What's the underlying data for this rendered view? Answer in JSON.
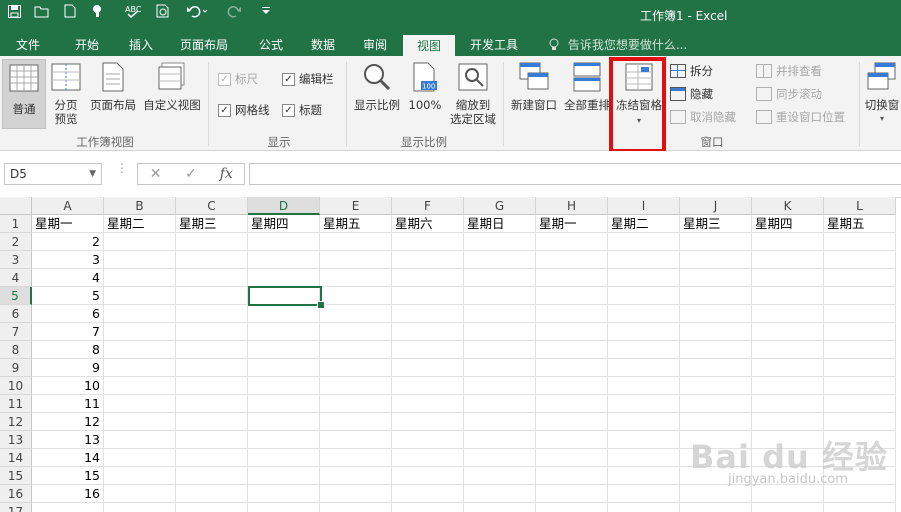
{
  "window": {
    "title": "工作簿1 - Excel"
  },
  "qat": [
    "save-icon",
    "open-folder-icon",
    "new-file-icon",
    "touch-mode-icon",
    "spell-check-icon",
    "print-preview-icon",
    "undo-icon",
    "redo-icon",
    "customize-qat-icon"
  ],
  "tabs": [
    {
      "label": "文件"
    },
    {
      "label": "开始"
    },
    {
      "label": "插入"
    },
    {
      "label": "页面布局"
    },
    {
      "label": "公式"
    },
    {
      "label": "数据"
    },
    {
      "label": "审阅"
    },
    {
      "label": "视图"
    },
    {
      "label": "开发工具"
    }
  ],
  "active_tab": "视图",
  "tell_me": "告诉我您想要做什么...",
  "ribbon": {
    "workbook_views": {
      "label": "工作簿视图",
      "normal": "普通",
      "page_break": "分页\n预览",
      "page_layout": "页面布局",
      "custom": "自定义视图"
    },
    "show": {
      "label": "显示",
      "ruler": "标尺",
      "formula_bar": "编辑栏",
      "gridlines": "网格线",
      "headings": "标题"
    },
    "zoom": {
      "label": "显示比例",
      "zoom": "显示比例",
      "hundred": "100%",
      "hundred_icon_text": "100",
      "to_selection": "缩放到\n选定区域"
    },
    "window": {
      "label": "窗口",
      "new_window": "新建窗口",
      "arrange_all": "全部重排",
      "freeze_panes": "冻结窗格",
      "split": "拆分",
      "hide": "隐藏",
      "unhide": "取消隐藏",
      "side_by_side": "并排查看",
      "sync_scroll": "同步滚动",
      "reset_position": "重设窗口位置",
      "switch": "切换窗"
    }
  },
  "formula_bar": {
    "name_box": "D5",
    "cancel": "✕",
    "enter": "✓",
    "fx": "fx",
    "value": ""
  },
  "columns": [
    "A",
    "B",
    "C",
    "D",
    "E",
    "F",
    "G",
    "H",
    "I",
    "J",
    "K",
    "L"
  ],
  "selected_col": "D",
  "rows": [
    "1",
    "2",
    "3",
    "4",
    "5",
    "6",
    "7",
    "8",
    "9",
    "10",
    "11",
    "12",
    "13",
    "14",
    "15",
    "16",
    "17"
  ],
  "selected_row": "5",
  "row1": [
    "星期一",
    "星期二",
    "星期三",
    "星期四",
    "星期五",
    "星期六",
    "星期日",
    "星期一",
    "星期二",
    "星期三",
    "星期四",
    "星期五"
  ],
  "colA": [
    "2",
    "3",
    "4",
    "5",
    "6",
    "7",
    "8",
    "9",
    "10",
    "11",
    "12",
    "13",
    "14",
    "15",
    "16",
    ""
  ],
  "watermark": {
    "brand": "Bai du 经验",
    "url": "jingyan.baidu.com"
  },
  "colors": {
    "accent": "#217346",
    "highlight": "#e01010"
  }
}
